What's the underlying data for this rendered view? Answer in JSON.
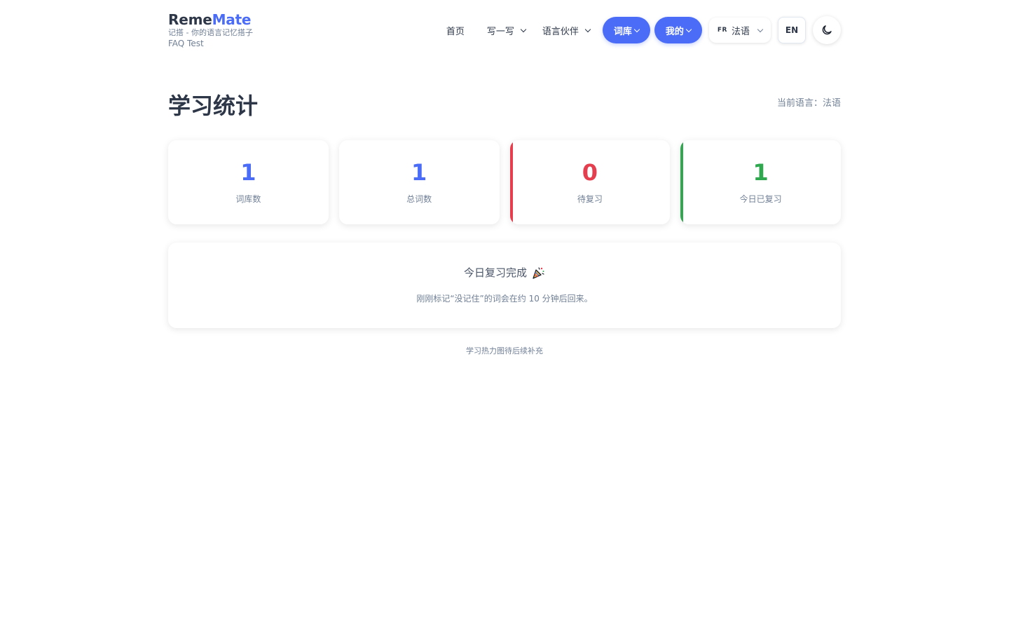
{
  "brand": {
    "name_part1": "Reme",
    "name_part2": "Mate",
    "subtitle": "记搭 - 你的语言记忆搭子",
    "subtitle2": "FAQ Test"
  },
  "nav": {
    "home": "首页",
    "write": "写一写",
    "partner": "语言伙伴",
    "vocab": "词库",
    "mine": "我的",
    "lang_code": "FR",
    "lang_name": "法语",
    "ui_lang": "EN",
    "theme_icon": "moon-icon"
  },
  "page": {
    "title": "学习统计",
    "current_language": "当前语言：法语"
  },
  "stats": [
    {
      "value": "1",
      "label": "词库数",
      "color": "#4a6cf7"
    },
    {
      "value": "1",
      "label": "总词数",
      "color": "#4a6cf7"
    },
    {
      "value": "0",
      "label": "待复习",
      "color": "#e53e4e"
    },
    {
      "value": "1",
      "label": "今日已复习",
      "color": "#2fa84f"
    }
  ],
  "review": {
    "title": "今日复习完成",
    "emoji": "party-popper-icon",
    "description": "刚刚标记“没记住”的词会在约 10 分钟后回来。"
  },
  "footer_note": "学习热力图待后续补充"
}
